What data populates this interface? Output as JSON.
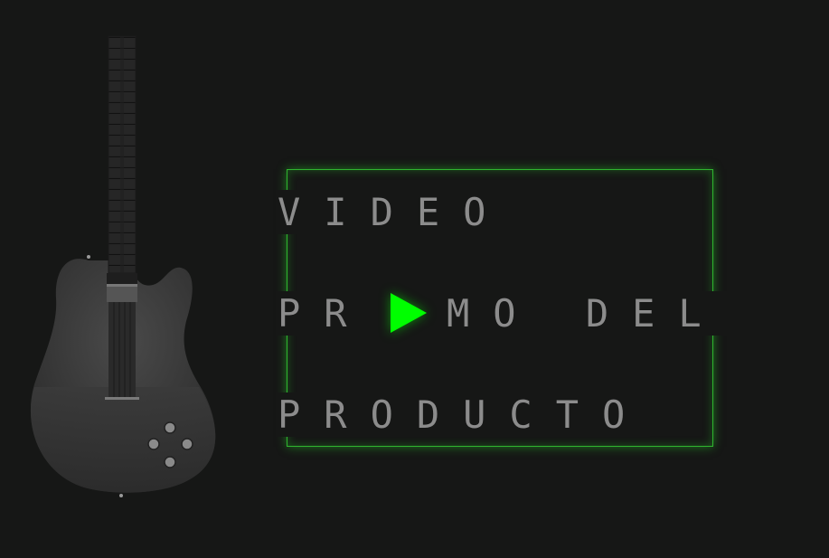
{
  "promo": {
    "line1": "VIDEO",
    "line2_left": "PR",
    "line2_right": "MO DEL",
    "line3": "PRODUCTO"
  },
  "colors": {
    "background": "#161716",
    "text": "#8c8c8c",
    "frame": "#2fb52f",
    "play": "#00ff00"
  },
  "icons": {
    "play": "play-icon",
    "guitar": "electric-guitar-illustration"
  }
}
